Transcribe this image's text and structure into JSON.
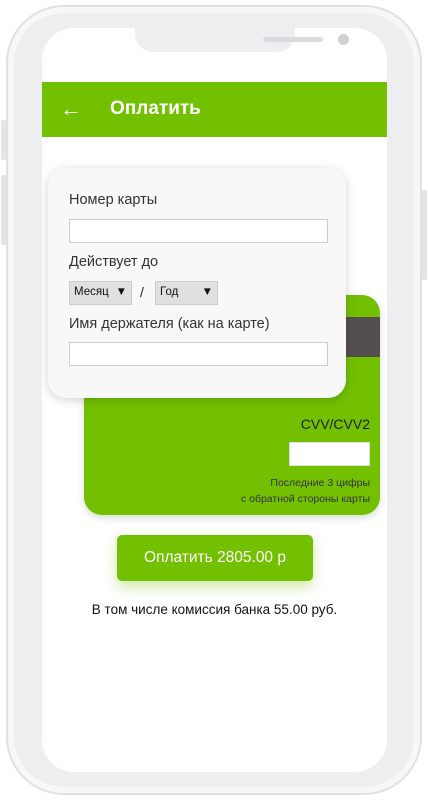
{
  "header": {
    "title": "Оплатить",
    "back_icon": "arrow-left-icon"
  },
  "form": {
    "card_number_label": "Номер карты",
    "card_number_value": "",
    "expiry_label": "Действует до",
    "month_selected": "Месяц",
    "year_selected": "Год",
    "separator": "/",
    "holder_label": "Имя держателя (как на карте)",
    "holder_value": ""
  },
  "card_back": {
    "cvv_label": "CVV/CVV2",
    "cvv_value": "",
    "hint_line1": "Последние 3 цифры",
    "hint_line2": "с обратной стороны карты"
  },
  "pay_button": "Оплатить 2805.00 р",
  "fee_text": "В том числе комиссия банка 55.00 руб.",
  "colors": {
    "accent": "#72c000",
    "stripe": "#554e4f"
  }
}
